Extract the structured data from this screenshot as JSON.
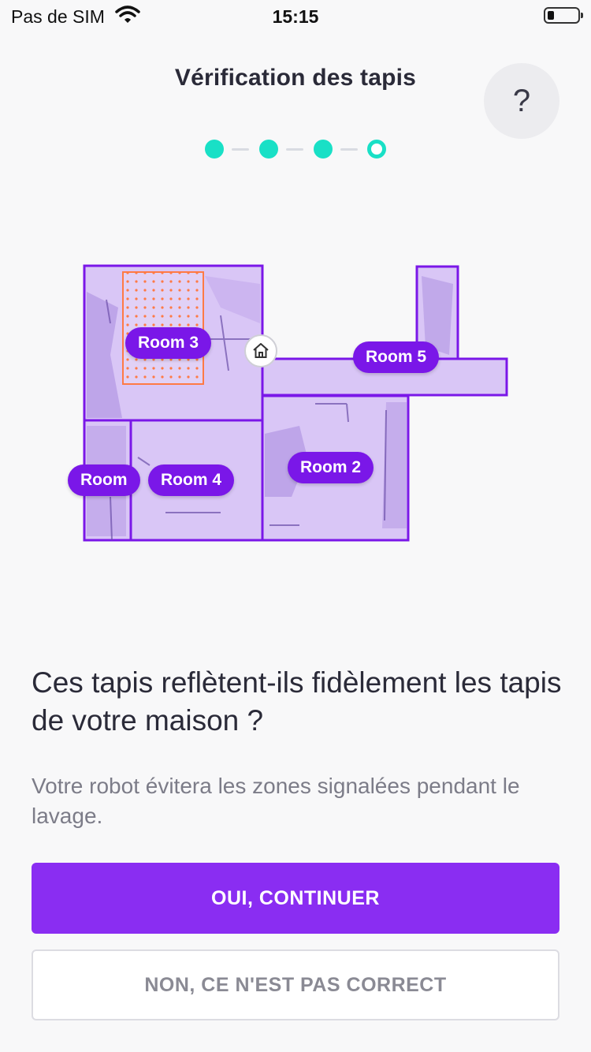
{
  "status_bar": {
    "carrier": "Pas de SIM",
    "time": "15:15"
  },
  "header": {
    "title": "Vérification des tapis",
    "help_label": "?"
  },
  "stepper": {
    "total": 4,
    "current": 4
  },
  "map": {
    "rooms": [
      {
        "label": "Room 3"
      },
      {
        "label": "Room 5"
      },
      {
        "label": "Room 2"
      },
      {
        "label": "Room"
      },
      {
        "label": "Room 4"
      }
    ],
    "home_icon": "home-icon",
    "colors": {
      "room_fill": "#dccbf7",
      "room_border": "#7a17e8",
      "rug_area": "#ff7a45",
      "label_bg": "#7a17e8"
    }
  },
  "content": {
    "question": "Ces tapis reflètent-ils fidèlement les tapis de votre maison ?",
    "subtext": "Votre robot évitera les zones signalées pendant le lavage."
  },
  "actions": {
    "confirm_label": "OUI, CONTINUER",
    "reject_label": "NON, CE N'EST PAS CORRECT"
  },
  "colors": {
    "accent": "#8a2df2",
    "stepper": "#19e0c6"
  }
}
